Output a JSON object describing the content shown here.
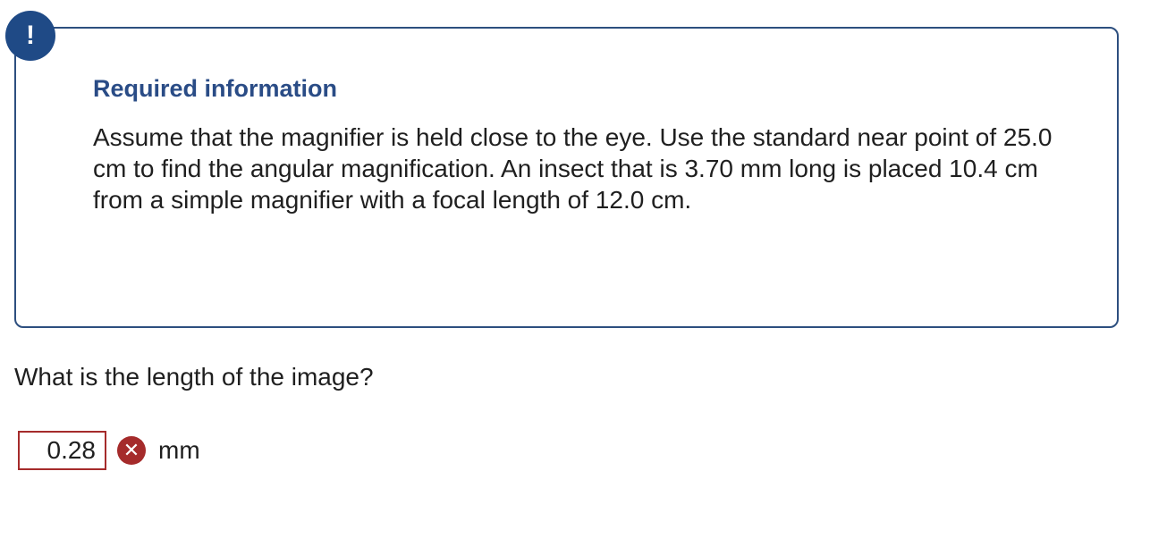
{
  "colors": {
    "alert_badge": "#1f4a86",
    "info_border": "#2d4f7f",
    "title": "#2a4c86",
    "error": "#a52b2b",
    "text": "#1f1f1f"
  },
  "alert": {
    "icon": "exclamation-icon",
    "symbol": "!"
  },
  "info_box": {
    "title": "Required information",
    "body": "Assume that the magnifier is held close to the eye. Use the standard near point of 25.0 cm to find the angular magnification. An insect that is 3.70 mm long is placed 10.4 cm from a simple magnifier with a focal length of 12.0 cm."
  },
  "question": {
    "text": "What is the length of the image?"
  },
  "answer": {
    "value": "0.28",
    "status_icon": "incorrect-x-icon",
    "status_symbol": "✕",
    "unit": "mm"
  }
}
